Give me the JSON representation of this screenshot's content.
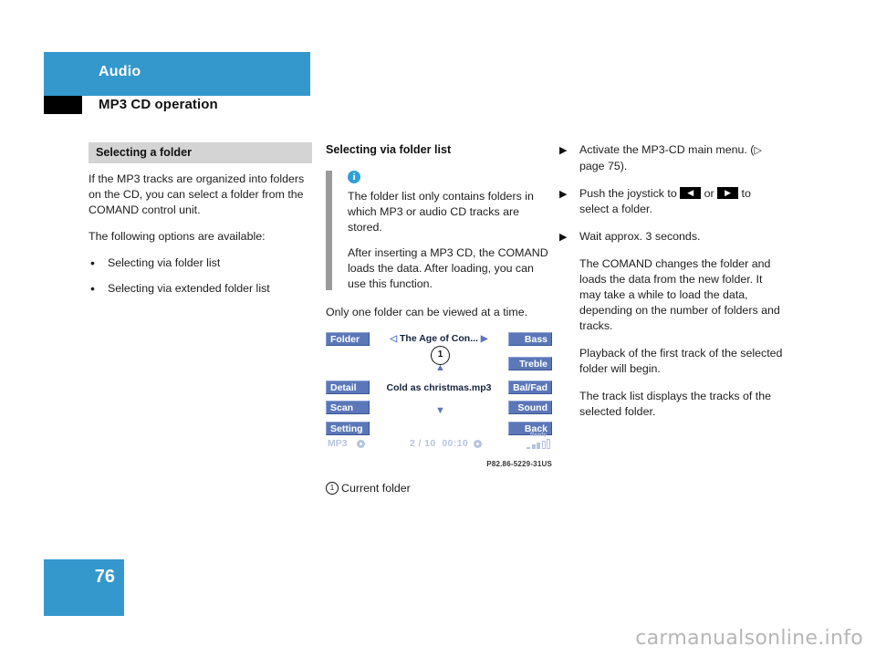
{
  "header": {
    "chapter": "Audio",
    "section": "MP3 CD operation",
    "band_color": "#3498cc"
  },
  "left_column": {
    "subhead": "Selecting a folder",
    "paragraph_1": "If the MP3 tracks are organized into folders on the CD, you can select a folder from the COMAND control unit.",
    "paragraph_2": "The following options are available:",
    "bullets": [
      {
        "marker": "•",
        "text": "Selecting via folder list"
      },
      {
        "marker": "•",
        "text": "Selecting via extended folder list"
      }
    ]
  },
  "middle_column": {
    "subhead": "Selecting via folder list",
    "note": {
      "icon_char": "i",
      "paragraph_1": "The folder list only contains folders in which MP3 or audio CD tracks are stored.",
      "paragraph_2": "After inserting a MP3 CD, the COMAND loads the data. After loading, you can use this function."
    },
    "paragraph_after_note": "Only one folder can be viewed at a time."
  },
  "right_column": {
    "steps": [
      {
        "arrow": "▶",
        "segments": [
          {
            "type": "text",
            "value": "Activate the MP3-CD main menu. ("
          },
          {
            "type": "pageref",
            "value": "▷"
          },
          {
            "type": "text",
            "value": " page 75)."
          }
        ]
      },
      {
        "arrow": "▶",
        "segments": [
          {
            "type": "text",
            "value": "Push the joystick to "
          },
          {
            "type": "kbd",
            "value": "◀"
          },
          {
            "type": "text",
            "value": " or "
          },
          {
            "type": "kbd",
            "value": "▶"
          },
          {
            "type": "text",
            "value": " to select a folder."
          }
        ]
      },
      {
        "arrow": "▶",
        "segments": [
          {
            "type": "text",
            "value": "Wait approx. 3 seconds."
          }
        ]
      }
    ],
    "notes": [
      "The COMAND changes the folder and loads the data from the new folder. It may take a while to load the data, depending on the number of folders and tracks.",
      "Playback of the first track of the selected folder will begin.",
      "The track list displays the tracks of the selected folder."
    ]
  },
  "comand_screen": {
    "button_color": "#5c77b8",
    "left_buttons": [
      {
        "label": "Folder"
      },
      {
        "label": "Detail"
      },
      {
        "label": "Scan"
      },
      {
        "label": "Setting"
      }
    ],
    "right_buttons": [
      {
        "label": "Bass"
      },
      {
        "label": "Treble"
      },
      {
        "label": "Bal/Fad"
      },
      {
        "label": "Sound"
      },
      {
        "label": "Back"
      }
    ],
    "folder_nav_prev": "◁",
    "folder_name": "The Age of Con...",
    "folder_nav_next": "▶",
    "track_name": "Cold as christmas.mp3",
    "scroll_up": "▲",
    "scroll_down": "▼",
    "callout_number": "1",
    "status": {
      "source": "MP3",
      "track_position": "2 / 10",
      "elapsed_time": "00:10",
      "ready_label": "Ready"
    },
    "figure_code": "P82.86-5229-31US"
  },
  "figure_legend": {
    "number": "1",
    "text": "Current folder"
  },
  "footer": {
    "page_number": "76",
    "watermark": "carmanualsonline.info"
  }
}
